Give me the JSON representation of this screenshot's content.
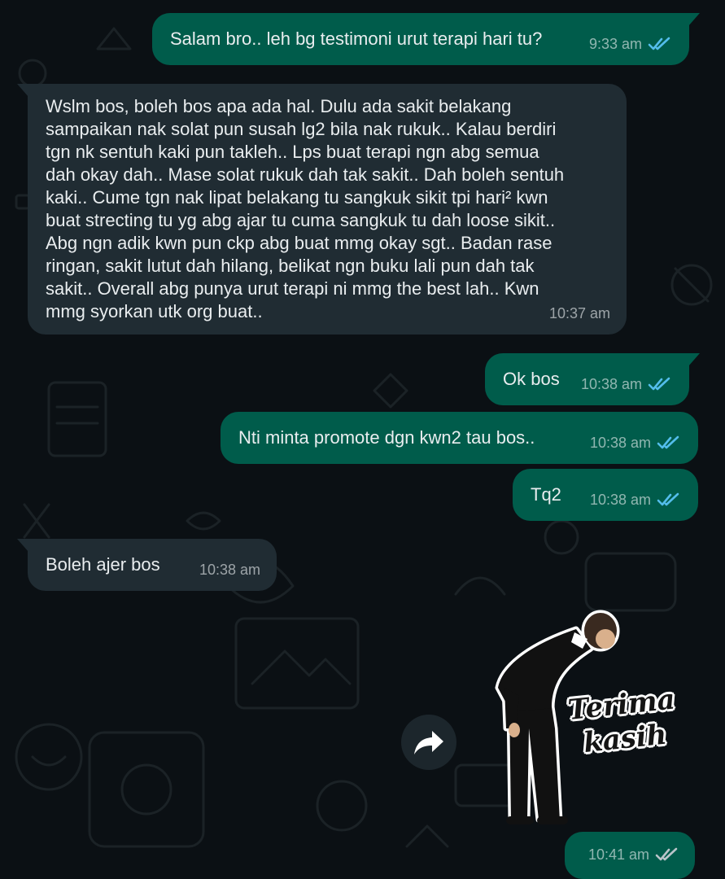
{
  "messages": [
    {
      "direction": "outgoing",
      "text": "Salam bro.. leh bg testimoni urut terapi hari tu?",
      "time": "9:33 am",
      "status": "read"
    },
    {
      "direction": "incoming",
      "lines": [
        "Wslm bos, boleh bos apa ada hal. Dulu ada sakit belakang",
        "sampaikan nak solat pun susah lg2 bila nak rukuk.. Kalau berdiri",
        "tgn nk sentuh kaki pun takleh.. Lps buat terapi ngn abg semua",
        "dah okay dah.. Mase solat rukuk dah tak sakit.. Dah boleh sentuh",
        "kaki.. Cume tgn nak lipat belakang tu sangkuk sikit tpi hari² kwn",
        "buat strecting tu yg abg ajar tu cuma sangkuk tu dah loose sikit..",
        "Abg ngn adik kwn pun ckp abg buat mmg okay sgt.. Badan rase",
        "ringan, sakit lutut dah hilang, belikat ngn buku lali pun dah tak",
        "sakit.. Overall abg punya urut terapi ni mmg the best lah.. Kwn",
        "mmg syorkan utk org buat.."
      ],
      "time": "10:37 am"
    },
    {
      "direction": "outgoing",
      "text": "Ok bos",
      "time": "10:38 am",
      "status": "read"
    },
    {
      "direction": "outgoing",
      "text": "Nti minta promote dgn kwn2 tau bos..",
      "time": "10:38 am",
      "status": "read"
    },
    {
      "direction": "outgoing",
      "text": "Tq2",
      "time": "10:38 am",
      "status": "read"
    },
    {
      "direction": "incoming",
      "text": "Boleh ajer bos",
      "time": "10:38 am"
    },
    {
      "direction": "outgoing",
      "type": "sticker",
      "sticker_text": [
        "Terima",
        "kasih"
      ],
      "time": "10:41 am",
      "status": "delivered"
    }
  ],
  "icons": {
    "forward": "forward-arrow-icon",
    "read_receipt": "double-check-icon"
  },
  "colors": {
    "background": "#0b1014",
    "outgoing_bubble": "#005c4b",
    "incoming_bubble": "#202c33",
    "text": "#e9edef",
    "read_ticks": "#53bdeb",
    "delivered_ticks": "#8696a0"
  }
}
